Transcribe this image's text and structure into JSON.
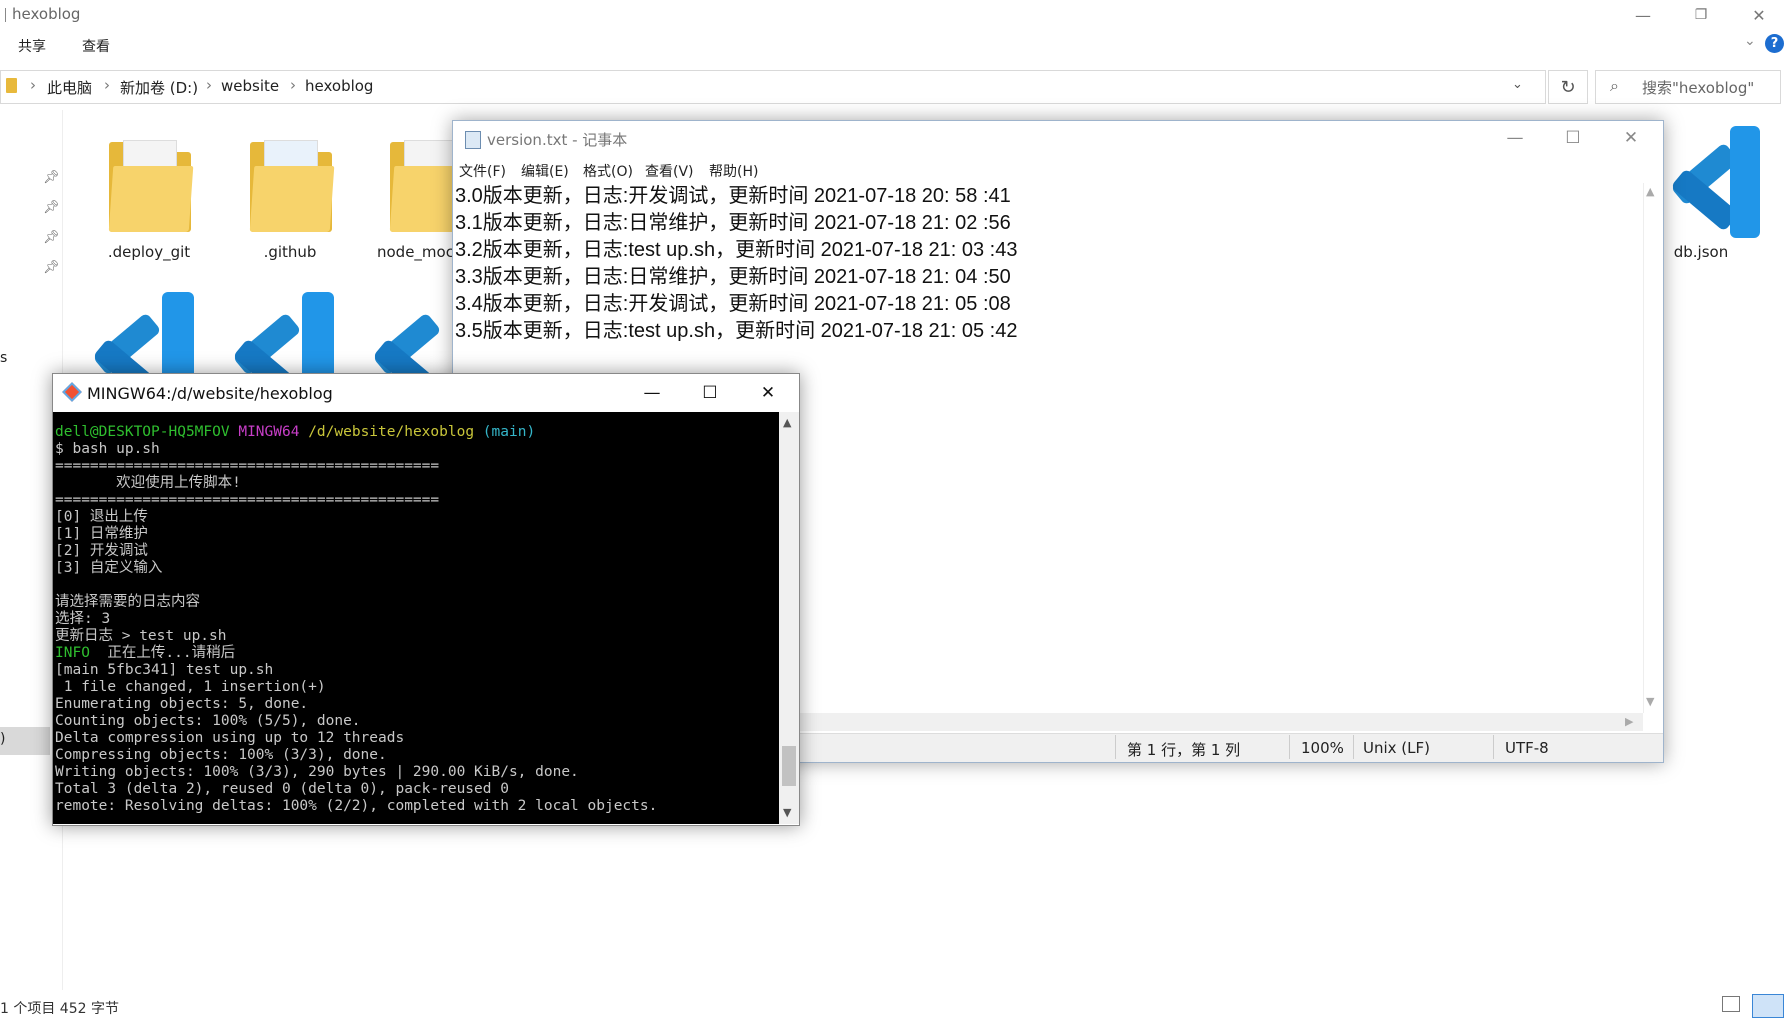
{
  "explorer": {
    "title": "hexoblog",
    "ribbon_tabs": [
      "共享",
      "查看"
    ],
    "window_controls": [
      "—",
      "❐",
      "✕"
    ],
    "help_icon": "?",
    "breadcrumb": [
      "此电脑",
      "新加卷 (D:)",
      "website",
      "hexoblog"
    ],
    "search_placeholder": "搜索\"hexoblog\"",
    "files": [
      {
        "name": ".deploy_git",
        "icon": "folder-icon"
      },
      {
        "name": ".github",
        "icon": "folder-icon"
      },
      {
        "name": "node_moc",
        "icon": "folder-icon"
      },
      {
        "name": "db.json",
        "icon": "vscode-icon"
      }
    ],
    "status": "1 个项目  452 字节",
    "nav_fragments": [
      "s",
      ")"
    ]
  },
  "notepad": {
    "title": "version.txt - 记事本",
    "menu": [
      "文件(F)",
      "编辑(E)",
      "格式(O)",
      "查看(V)",
      "帮助(H)"
    ],
    "lines": [
      "3.0版本更新，日志:开发调试，更新时间 2021-07-18 20: 58 :41",
      "3.1版本更新，日志:日常维护，更新时间 2021-07-18 21: 02 :56",
      "3.2版本更新，日志:test up.sh，更新时间 2021-07-18 21: 03 :43",
      "3.3版本更新，日志:日常维护，更新时间 2021-07-18 21: 04 :50",
      "3.4版本更新，日志:开发调试，更新时间 2021-07-18 21: 05 :08",
      "3.5版本更新，日志:test up.sh，更新时间 2021-07-18 21: 05 :42"
    ],
    "status": {
      "position": "第 1 行，第 1 列",
      "zoom": "100%",
      "eol": "Unix (LF)",
      "encoding": "UTF-8"
    }
  },
  "bash": {
    "title": "MINGW64:/d/website/hexoblog",
    "prompt": {
      "user": "dell@DESKTOP-HQ5MFOV",
      "env": "MINGW64",
      "path": "/d/website/hexoblog",
      "branch": "(main)"
    },
    "lines": [
      "$ bash up.sh",
      "============================================",
      "       欢迎使用上传脚本!",
      "============================================",
      "[0] 退出上传",
      "[1] 日常维护",
      "[2] 开发调试",
      "[3] 自定义输入",
      "",
      "请选择需要的日志内容",
      "选择: 3",
      "更新日志 > test up.sh"
    ],
    "info_tag": "INFO",
    "info_text": "  正在上传...请稍后",
    "lines_after": [
      "[main 5fbc341] test up.sh",
      " 1 file changed, 1 insertion(+)",
      "Enumerating objects: 5, done.",
      "Counting objects: 100% (5/5), done.",
      "Delta compression using up to 12 threads",
      "Compressing objects: 100% (3/3), done.",
      "Writing objects: 100% (3/3), 290 bytes | 290.00 KiB/s, done.",
      "Total 3 (delta 2), reused 0 (delta 0), pack-reused 0",
      "remote: Resolving deltas: 100% (2/2), completed with 2 local objects."
    ]
  }
}
